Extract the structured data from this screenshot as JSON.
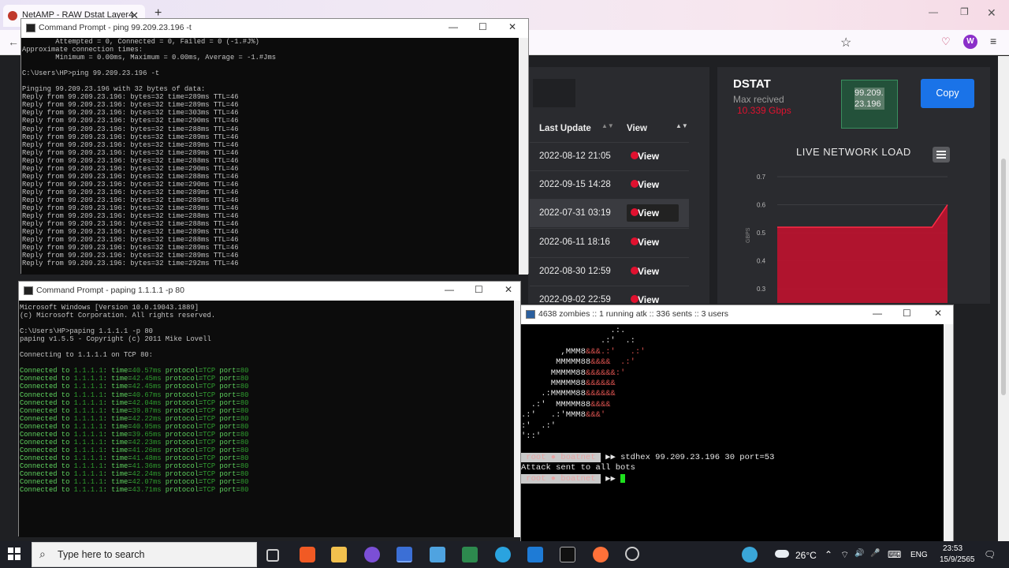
{
  "browser": {
    "tab_title": "NetAMP - RAW Dstat Layer4",
    "tab_close": "✕",
    "new_tab": "+",
    "win_min": "—",
    "win_max": "❐",
    "win_close": "✕",
    "back": "←",
    "star": "☆",
    "pocket": "♡",
    "avatar_letter": "W",
    "menu": "≡"
  },
  "table": {
    "headers": [
      "Last Update",
      "View"
    ],
    "rows": [
      {
        "date": "2022-08-12 21:05",
        "view": "View"
      },
      {
        "date": "2022-09-15 14:28",
        "view": "View"
      },
      {
        "date": "2022-07-31 03:19",
        "view": "View"
      },
      {
        "date": "2022-06-11 18:16",
        "view": "View"
      },
      {
        "date": "2022-08-30 12:59",
        "view": "View"
      },
      {
        "date": "2022-09-02 22:59",
        "view": "View"
      }
    ]
  },
  "dstat": {
    "title": "DSTAT",
    "max_label": "Max recived",
    "max_value": "10.339 Gbps",
    "ip": "99.209.23.196",
    "copy_label": "Copy",
    "live_title": "LIVE NETWORK LOAD",
    "accent": "#e0112f"
  },
  "chart_data": {
    "type": "area",
    "title": "LIVE NETWORK LOAD",
    "ylabel": "GBPS",
    "yticks": [
      "0.7",
      "0.6",
      "0.5",
      "0.4",
      "0.3"
    ],
    "ylim": [
      0.25,
      0.7
    ],
    "series": [
      {
        "values": [
          0.52,
          0.52,
          0.52,
          0.52,
          0.52,
          0.52,
          0.52,
          0.52,
          0.52,
          0.52,
          0.52,
          0.6
        ]
      }
    ],
    "color": "#c8102e"
  },
  "ping_window": {
    "title": "Command Prompt - ping  99.209.23.196 -t",
    "min": "—",
    "max": "☐",
    "close": "✕",
    "lines": [
      "        Attempted = 0, Connected = 0, Failed = 0 (-1.#J%)",
      "Approximate connection times:",
      "        Minimum = 0.00ms, Maximum = 0.00ms, Average = -1.#Jms",
      "",
      "C:\\Users\\HP>ping 99.209.23.196 -t",
      "",
      "Pinging 99.209.23.196 with 32 bytes of data:",
      "Reply from 99.209.23.196: bytes=32 time=289ms TTL=46",
      "Reply from 99.209.23.196: bytes=32 time=289ms TTL=46",
      "Reply from 99.209.23.196: bytes=32 time=303ms TTL=46",
      "Reply from 99.209.23.196: bytes=32 time=290ms TTL=46",
      "Reply from 99.209.23.196: bytes=32 time=288ms TTL=46",
      "Reply from 99.209.23.196: bytes=32 time=289ms TTL=46",
      "Reply from 99.209.23.196: bytes=32 time=289ms TTL=46",
      "Reply from 99.209.23.196: bytes=32 time=289ms TTL=46",
      "Reply from 99.209.23.196: bytes=32 time=288ms TTL=46",
      "Reply from 99.209.23.196: bytes=32 time=290ms TTL=46",
      "Reply from 99.209.23.196: bytes=32 time=288ms TTL=46",
      "Reply from 99.209.23.196: bytes=32 time=290ms TTL=46",
      "Reply from 99.209.23.196: bytes=32 time=289ms TTL=46",
      "Reply from 99.209.23.196: bytes=32 time=289ms TTL=46",
      "Reply from 99.209.23.196: bytes=32 time=289ms TTL=46",
      "Reply from 99.209.23.196: bytes=32 time=288ms TTL=46",
      "Reply from 99.209.23.196: bytes=32 time=288ms TTL=46",
      "Reply from 99.209.23.196: bytes=32 time=289ms TTL=46",
      "Reply from 99.209.23.196: bytes=32 time=288ms TTL=46",
      "Reply from 99.209.23.196: bytes=32 time=289ms TTL=46",
      "Reply from 99.209.23.196: bytes=32 time=289ms TTL=46",
      "Reply from 99.209.23.196: bytes=32 time=292ms TTL=46"
    ]
  },
  "paping_window": {
    "title": "Command Prompt - paping  1.1.1.1 -p 80",
    "min": "—",
    "max": "☐",
    "close": "✕",
    "header_lines": [
      "Microsoft Windows [Version 10.0.19043.1889]",
      "(c) Microsoft Corporation. All rights reserved.",
      "",
      "C:\\Users\\HP>paping 1.1.1.1 -p 80",
      "paping v1.5.5 - Copyright (c) 2011 Mike Lovell",
      "",
      "Connecting to 1.1.1.1 on TCP 80:",
      ""
    ],
    "conn_prefix": "Connected to ",
    "conn_host": "1.1.1.1",
    "conn_time_label": ": time=",
    "conn_proto_label": " protocol=",
    "conn_proto": "TCP",
    "conn_port_label": " port=",
    "conn_port": "80",
    "times": [
      "40.57ms",
      "42.45ms",
      "42.45ms",
      "40.67ms",
      "42.04ms",
      "39.87ms",
      "42.22ms",
      "40.95ms",
      "39.65ms",
      "42.23ms",
      "41.26ms",
      "41.48ms",
      "41.36ms",
      "42.24ms",
      "42.07ms",
      "43.71ms"
    ]
  },
  "bot_window": {
    "title": "4638 zombies :: 1 running atk :: 336 sents :: 3 users",
    "min": "—",
    "max": "☐",
    "close": "✕",
    "art": [
      [
        "                  .:.",
        ""
      ],
      [
        "                .:'  .:",
        ""
      ],
      [
        "        ,MMM8",
        "&&&.:'   .:'"
      ],
      [
        "       MMMMM88",
        "&&&&  .:'"
      ],
      [
        "      MMMMM88",
        "&&&&&&:'"
      ],
      [
        "      MMMMM88",
        "&&&&&&"
      ],
      [
        "    .:MMMMM88",
        "&&&&&&"
      ],
      [
        "  .:'  MMMMM88",
        "&&&&"
      ],
      [
        ".:'   .:'MMM8",
        "&&&'"
      ],
      [
        ":'  .:'",
        ""
      ],
      [
        "'::'",
        ""
      ]
    ],
    "prompt_user": "root",
    "prompt_dot": "●",
    "prompt_host": "boatnet",
    "prompt_arrow": "▶▶",
    "command": "stdhex 99.209.23.196 30 port=53",
    "response": "Attack sent to all bots"
  },
  "taskbar": {
    "search_placeholder": "Type here to search",
    "search_icon": "⌕",
    "weather": "26°C",
    "lang": "ENG",
    "time": "23:53",
    "date": "15/9/2565",
    "tray_up": "⌃",
    "tray_wifi": "⌔",
    "tray_sound": "🔊",
    "tray_mic": "🎤",
    "tray_kbd": "⌨",
    "tray_notify": "🗨"
  }
}
